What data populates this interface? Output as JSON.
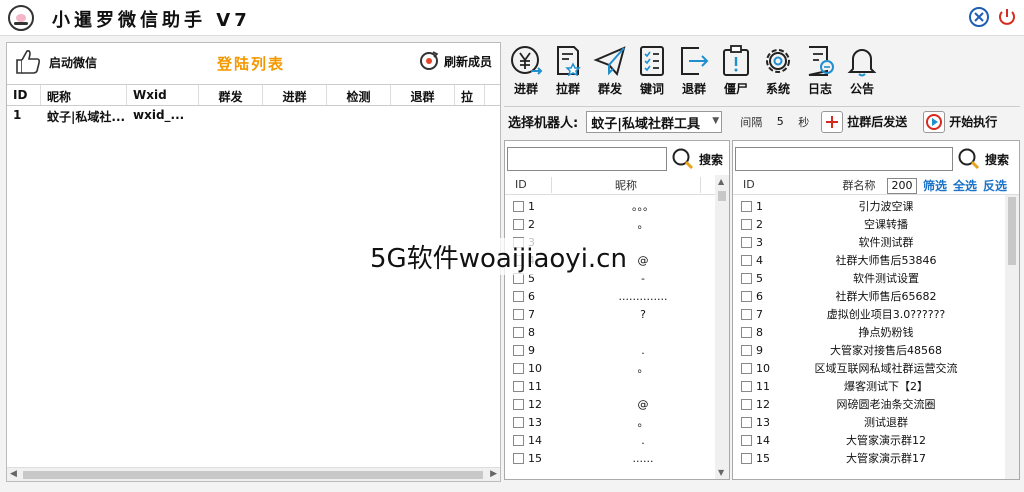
{
  "window": {
    "title": "小暹罗微信助手  V7"
  },
  "left": {
    "start_label": "启动微信",
    "list_title": "登陆列表",
    "refresh_label": "刷新成员",
    "columns": [
      "ID",
      "昵称",
      "Wxid",
      "群发",
      "进群",
      "检测",
      "退群",
      "拉"
    ],
    "rows": [
      {
        "id": "1",
        "nick": "蚊子|私域社...",
        "wxid": "wxid_..."
      }
    ]
  },
  "functions": [
    {
      "label": "进群",
      "icon": "yen-arrow-icon"
    },
    {
      "label": "拉群",
      "icon": "document-star-icon"
    },
    {
      "label": "群发",
      "icon": "paper-plane-icon"
    },
    {
      "label": "键词",
      "icon": "checklist-icon"
    },
    {
      "label": "退群",
      "icon": "exit-box-icon"
    },
    {
      "label": "僵尸",
      "icon": "exclamation-clipboard-icon"
    },
    {
      "label": "系统",
      "icon": "gear-icon"
    },
    {
      "label": "日志",
      "icon": "log-edit-icon"
    },
    {
      "label": "公告",
      "icon": "bell-icon"
    }
  ],
  "robot": {
    "label": "选择机器人:",
    "selected": "蚊子|私域社群工具",
    "interval_label": "间隔",
    "interval_value": "5",
    "interval_unit": "秒",
    "pull_send_label": "拉群后发送",
    "start_label": "开始执行"
  },
  "contacts": {
    "search_label": "搜索",
    "col_id": "ID",
    "col_name": "昵称",
    "rows": [
      {
        "id": "1",
        "name": "。。。"
      },
      {
        "id": "2",
        "name": "。"
      },
      {
        "id": "3",
        "name": ""
      },
      {
        "id": "4",
        "name": "@"
      },
      {
        "id": "5",
        "name": "-"
      },
      {
        "id": "6",
        "name": ".............."
      },
      {
        "id": "7",
        "name": "?"
      },
      {
        "id": "8",
        "name": ""
      },
      {
        "id": "9",
        "name": "."
      },
      {
        "id": "10",
        "name": "。"
      },
      {
        "id": "11",
        "name": ""
      },
      {
        "id": "12",
        "name": "@"
      },
      {
        "id": "13",
        "name": "。"
      },
      {
        "id": "14",
        "name": "."
      },
      {
        "id": "15",
        "name": "......"
      }
    ]
  },
  "groups": {
    "search_label": "搜索",
    "col_id": "ID",
    "col_name": "群名称",
    "batch_value": "200",
    "filter_label": "筛选",
    "select_all_label": "全选",
    "invert_label": "反选",
    "rows": [
      {
        "id": "1",
        "name": "引力波空课"
      },
      {
        "id": "2",
        "name": "空课转播"
      },
      {
        "id": "3",
        "name": "软件测试群"
      },
      {
        "id": "4",
        "name": "社群大师售后53846"
      },
      {
        "id": "5",
        "name": "软件测试设置"
      },
      {
        "id": "6",
        "name": "社群大师售后65682"
      },
      {
        "id": "7",
        "name": "虚拟创业项目3.0??????"
      },
      {
        "id": "8",
        "name": "挣点奶粉钱"
      },
      {
        "id": "9",
        "name": "大管家对接售后48568"
      },
      {
        "id": "10",
        "name": "区域互联网私域社群运营交流"
      },
      {
        "id": "11",
        "name": "爆客测试下【2】"
      },
      {
        "id": "12",
        "name": "网磅圆老油条交流圈"
      },
      {
        "id": "13",
        "name": "测试退群"
      },
      {
        "id": "14",
        "name": "大管家演示群12"
      },
      {
        "id": "15",
        "name": "大管家演示群17"
      }
    ]
  },
  "watermark": "5G软件woaijiaoyi.cn"
}
